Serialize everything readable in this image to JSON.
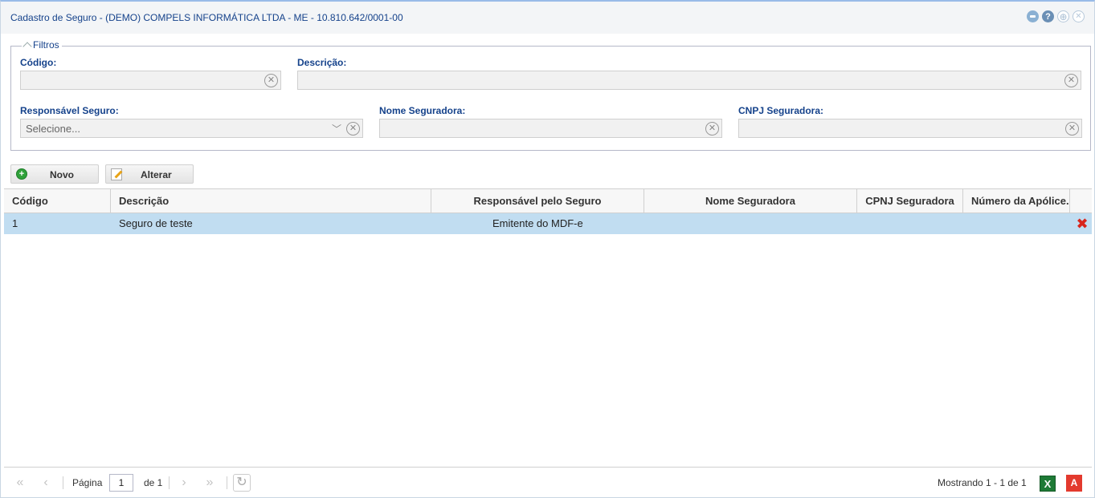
{
  "window": {
    "title": "Cadastro de Seguro - (DEMO) COMPELS INFORMÁTICA LTDA - ME - 10.810.642/0001-00",
    "help_glyph": "?",
    "max_glyph": "⊕",
    "close_glyph": "✕"
  },
  "filters": {
    "legend": "Filtros",
    "codigo_label": "Código:",
    "codigo_value": "",
    "descricao_label": "Descrição:",
    "descricao_value": "",
    "responsavel_label": "Responsável Seguro:",
    "responsavel_placeholder": "Selecione...",
    "nome_seguradora_label": "Nome Seguradora:",
    "nome_seguradora_value": "",
    "cnpj_seguradora_label": "CNPJ Seguradora:",
    "cnpj_seguradora_value": "",
    "clear_glyph": "✕",
    "chevron_glyph": "﹀"
  },
  "toolbar": {
    "novo_label": "Novo",
    "alterar_label": "Alterar",
    "add_glyph": "+"
  },
  "grid": {
    "columns": [
      "Código",
      "Descrição",
      "Responsável pelo Seguro",
      "Nome Seguradora",
      "CPNJ Seguradora",
      "Número da Apólice."
    ],
    "rows": [
      {
        "codigo": "1",
        "descricao": "Seguro de teste",
        "responsavel": "Emitente do MDF-e",
        "nome_seguradora": "",
        "cnpj_seguradora": "",
        "numero_apolice": ""
      }
    ],
    "delete_glyph": "✖"
  },
  "pager": {
    "first_glyph": "«",
    "prev_glyph": "‹",
    "next_glyph": "›",
    "last_glyph": "»",
    "refresh_glyph": "↻",
    "page_label": "Página",
    "page_value": "1",
    "of_label": "de 1",
    "summary": "Mostrando 1 - 1 de 1",
    "xls_glyph": "X",
    "pdf_glyph": "A"
  },
  "colors": {
    "title_text": "#15428b",
    "selected_row": "#c1ddf1",
    "delete_icon": "#d9251c",
    "excel_icon": "#1e7a36",
    "pdf_icon": "#e33a2e"
  }
}
